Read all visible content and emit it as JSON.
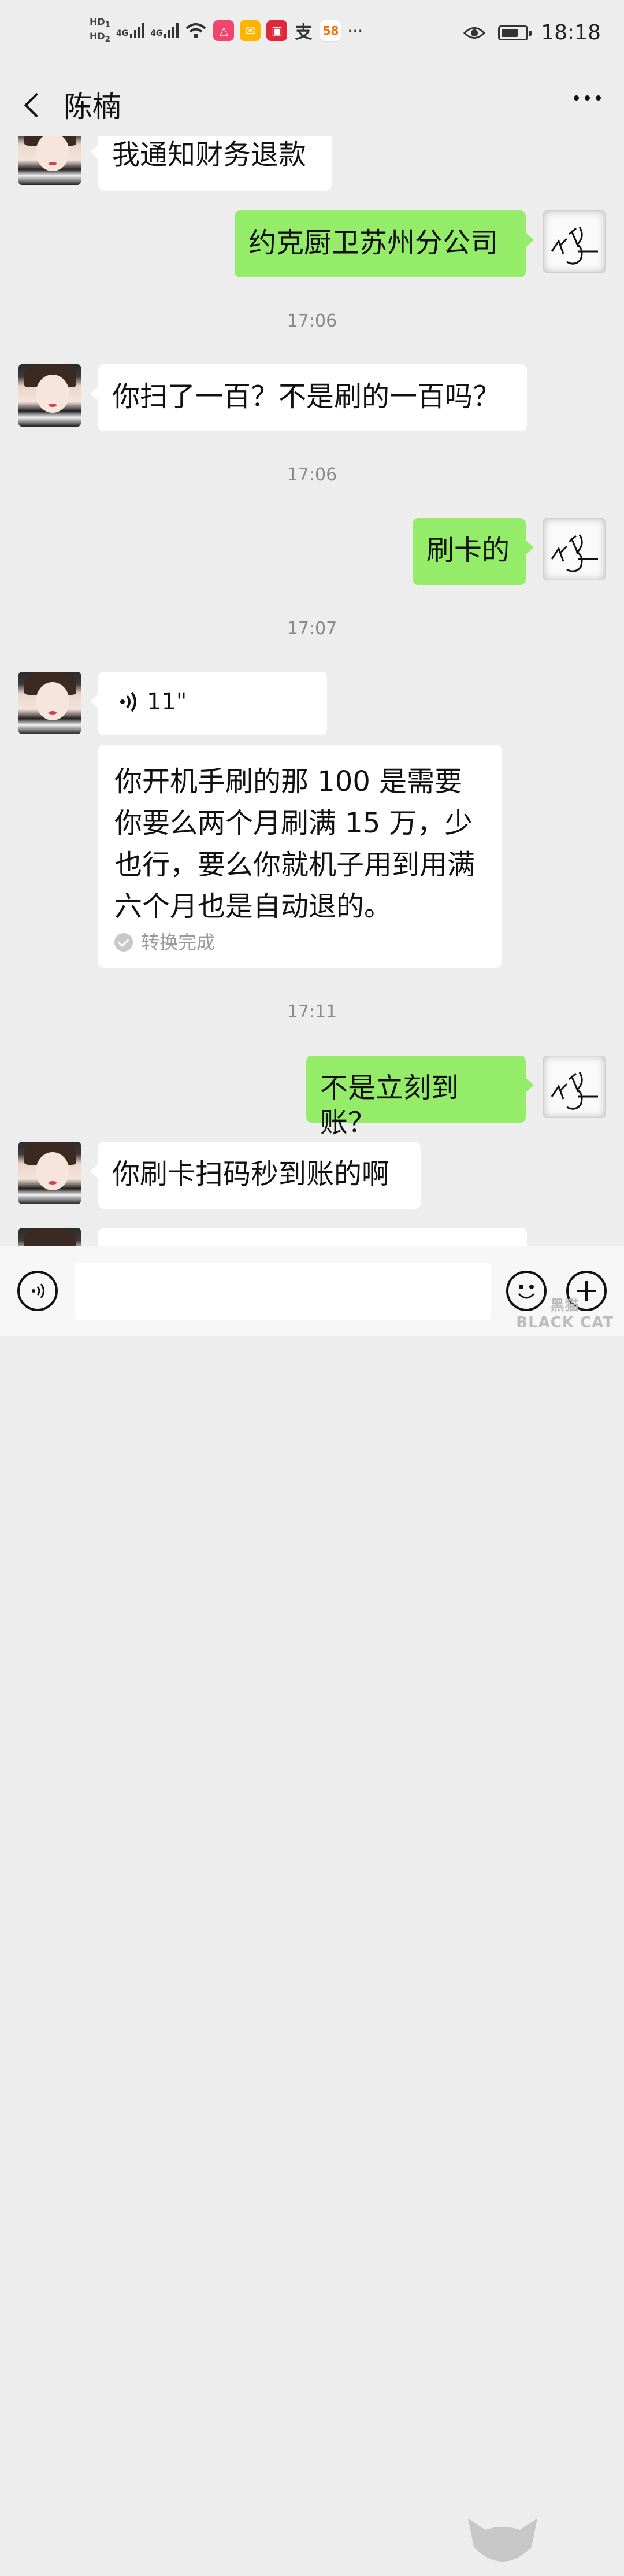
{
  "status_bar": {
    "hd1": "HD",
    "hd1_sub": "1",
    "hd2": "HD",
    "hd2_sub": "2",
    "net1": "4G",
    "net2": "4G",
    "app_icon_58": "58",
    "app_icon_alipay": "支",
    "more": "···",
    "time": "18:18",
    "battery_level": 0.7
  },
  "header": {
    "title": "陈楠"
  },
  "messages": [
    {
      "side": "left",
      "text": "我通知财务退款"
    },
    {
      "side": "right",
      "text": "约克厨卫苏州分公司"
    },
    {
      "type": "time",
      "text": "17:06"
    },
    {
      "side": "left",
      "text": "你扫了一百？不是刷的一百吗？"
    },
    {
      "type": "time",
      "text": "17:06"
    },
    {
      "side": "right",
      "text": "刷卡的"
    },
    {
      "type": "time",
      "text": "17:07"
    },
    {
      "side": "left",
      "type": "voice",
      "text": "11\""
    },
    {
      "side": "left",
      "type": "transcript",
      "text": "你开机手刷的那 100 是需要你要么两个月刷满 15 万，少也行，要么你就机子用到用满六个月也是自动退的。",
      "status": "转换完成"
    },
    {
      "type": "time",
      "text": "17:11"
    },
    {
      "side": "right",
      "text": "不是立刻到账？"
    },
    {
      "side": "left",
      "text": "你刷卡扫码秒到账的啊"
    }
  ],
  "watermark": "BLACK CAT",
  "watermark_cn": "黑猫"
}
